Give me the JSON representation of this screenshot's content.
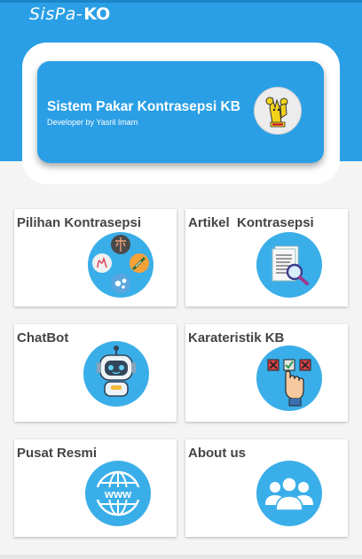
{
  "app": {
    "logo_primary": "SisPa-",
    "logo_secondary": "KO"
  },
  "banner": {
    "title": "Sistem Pakar Kontrasepsi KB",
    "subtitle": "Developer by Yasril Imam"
  },
  "menu": [
    {
      "label": "Pilihan Kontrasepsi",
      "icon": "contraception-options-icon"
    },
    {
      "label": "Artikel  Kontrasepsi",
      "icon": "article-search-icon"
    },
    {
      "label": "ChatBot",
      "icon": "robot-icon"
    },
    {
      "label": "Karateristik KB",
      "icon": "checklist-choice-icon"
    },
    {
      "label": "Pusat Resmi",
      "icon": "www-globe-icon"
    },
    {
      "label": "About us",
      "icon": "group-users-icon"
    }
  ],
  "colors": {
    "primary": "#2a9fe6",
    "icon_circle": "#3aaee8",
    "background": "#f4f4f4"
  }
}
